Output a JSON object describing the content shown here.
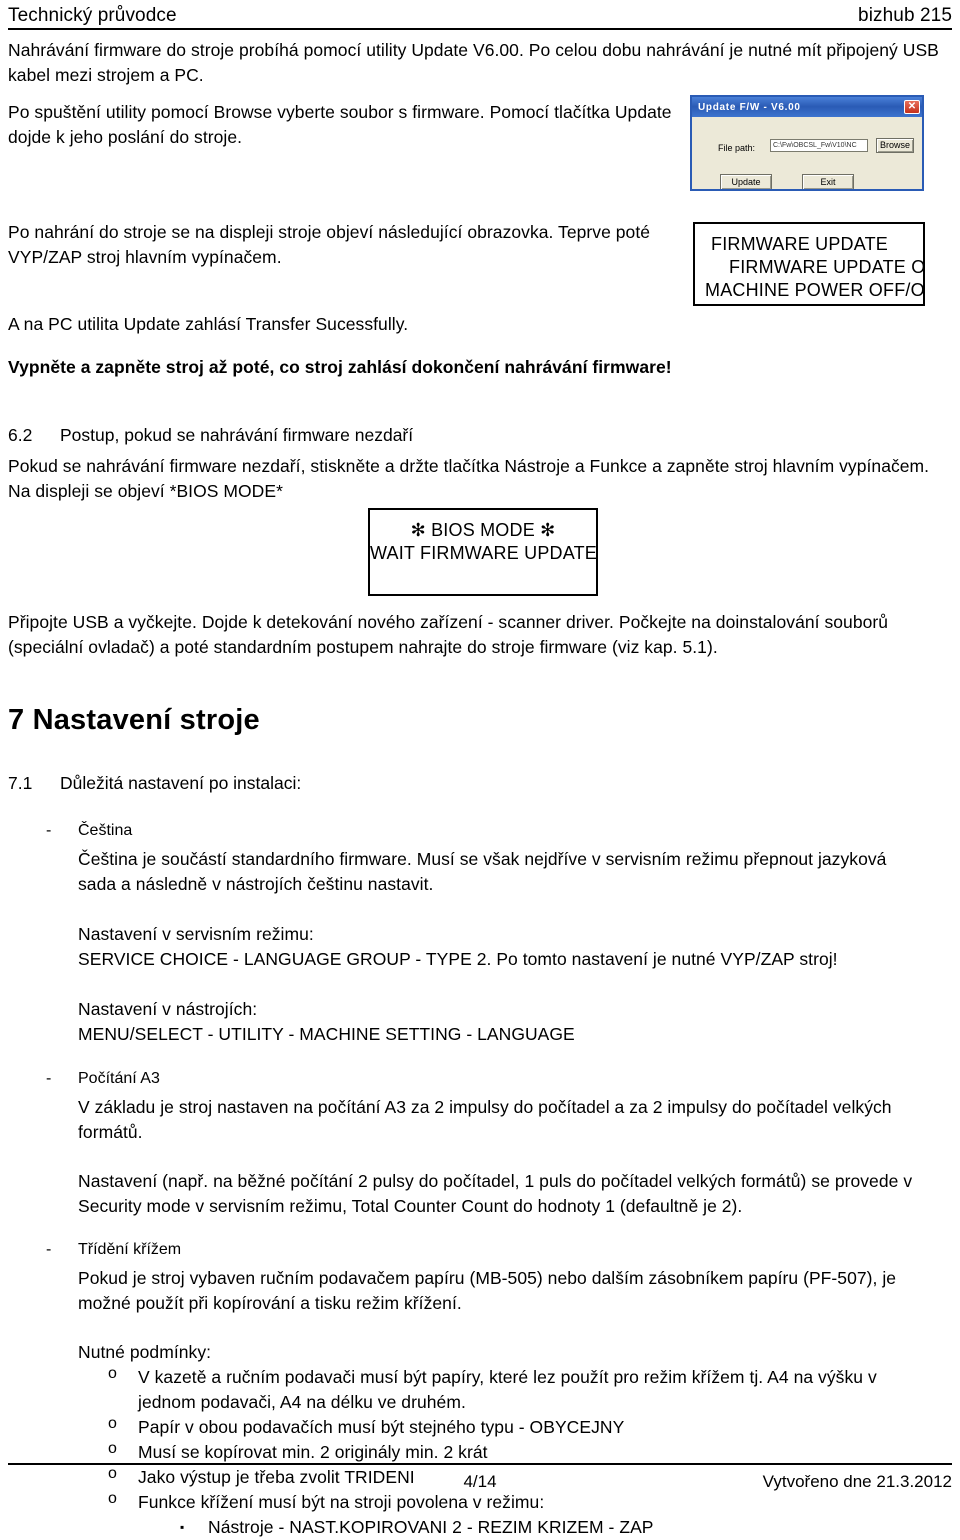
{
  "header": {
    "left": "Technický průvodce",
    "right": "bizhub 215"
  },
  "footer": {
    "page": "4/14",
    "date": "Vytvořeno dne 21.3.2012"
  },
  "body": {
    "p_intro": "Nahrávání firmware do stroje probíhá pomocí utility Update V6.00. Po celou dobu nahrávání je nutné mít připojený USB kabel mezi strojem a PC.",
    "p_browse": "Po spuštění utility pomocí Browse vyberte soubor s firmware. Pomocí tlačítka Update dojde k jeho poslání do stroje.",
    "p_after_upload": "Po nahrání do stroje se na displeji stroje objeví následující obrazovka. Teprve poté VYP/ZAP stroj hlavním vypínačem.",
    "p_transfer": "A na PC utilita Update zahlásí Transfer Sucessfully.",
    "p_warning_bold": "Vypněte a zapněte stroj až poté, co stroj zahlásí dokončení nahrávání firmware!",
    "p_fail_procedure": "Pokud se nahrávání firmware nezdaří, stiskněte a držte tlačítka Nástroje a Funkce a zapněte stroj hlavním vypínačem. Na displeji se objeví *BIOS MODE*",
    "p_usb": "Připojte USB a vyčkejte. Dojde k detekování nového zařízení - scanner driver. Počkejte na doinstalování souborů (speciální ovladač) a poté standardním postupem nahrajte do stroje firmware (viz kap. 5.1)."
  },
  "sections": {
    "s62_num": "6.2",
    "s62_title": "Postup, pokud se nahrávání firmware nezdaří",
    "chapter7": "7   Nastavení stroje",
    "s71_num": "7.1",
    "s71_title": "Důležitá nastavení po instalaci:"
  },
  "bullets": {
    "dash_mark": "-",
    "circle_mark": "o",
    "square_mark": "▪",
    "cestina": {
      "title": "Čeština",
      "text": "Čeština je součástí standardního firmware. Musí se však nejdříve v servisním režimu přepnout jazyková sada a následně v nástrojích češtinu nastavit.",
      "service_label": "Nastavení v servisním režimu:",
      "service_path": "SERVICE CHOICE - LANGUAGE GROUP - TYPE 2. Po tomto nastavení je nutné VYP/ZAP stroj!",
      "tools_label": "Nastavení v nástrojích:",
      "tools_path": "MENU/SELECT - UTILITY - MACHINE SETTING - LANGUAGE"
    },
    "pocitani_a3": {
      "title": "Počítání A3",
      "text": "V základu je stroj nastaven na počítání A3 za 2 impulsy do počítadel a za 2 impulsy do počítadel velkých formátů.",
      "note": "Nastavení (např. na běžné počítání 2 pulsy do počítadel, 1 puls do počítadel velkých formátů) se provede v Security mode v servisním režimu, Total Counter Count do hodnoty 1 (defaultně je 2)."
    },
    "trideni_krizem": {
      "title": "Třídění křížem",
      "text": "Pokud je stroj vybaven ručním podavačem papíru (MB-505) nebo dalším zásobníkem papíru (PF-507), je možné použít při kopírování a tisku režim křížení.",
      "conditions_label": "Nutné podmínky:",
      "conditions": [
        "V kazetě a ručním podavači musí být papíry, které lez použít pro režim křížem tj. A4 na výšku v jednom podavači, A4 na délku ve druhém.",
        "Papír v obou podavačích musí být stejného typu - OBYCEJNY",
        "Musí se kopírovat min. 2 originály min. 2 krát",
        "Jako výstup je třeba zvolit TRIDENI",
        "Funkce křížení musí být na stroji povolena v režimu:"
      ],
      "subcondition": "Nástroje - NAST.KOPIROVANI 2 - REZIM KRIZEM - ZAP"
    }
  },
  "update_dialog": {
    "title": "Update F/W - V6.00",
    "close_label": "✕",
    "file_path_label": "File path:",
    "file_path_value": "C:\\Fw\\OBCSL_Fw\\V10\\NC",
    "browse_label": "Browse",
    "update_label": "Update",
    "exit_label": "Exit"
  },
  "lcd_firmware": {
    "line1": "FIRMWARE UPDATE",
    "line2": "FIRMWARE UPDATE OK",
    "line3": "MACHINE POWER OFF/ON"
  },
  "lcd_bios": {
    "line1": "✻ BIOS  MODE ✻",
    "line2": "WAIT FIRMWARE UPDATE"
  },
  "colors": {
    "dialog_title_bar": "#2a5bb5",
    "dialog_face": "#ece9d8",
    "close_button": "#c4301b",
    "text": "#000000",
    "page_background": "#ffffff"
  }
}
